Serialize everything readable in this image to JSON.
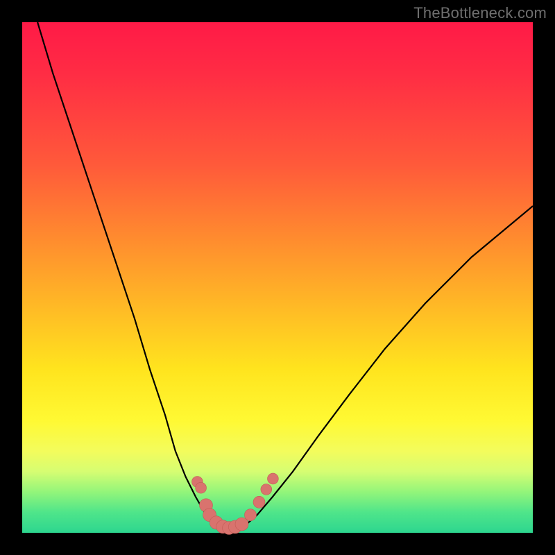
{
  "watermark": {
    "text": "TheBottleneck.com"
  },
  "colors": {
    "background": "#000000",
    "gradient_top": "#ff1a47",
    "gradient_mid": "#ffe41e",
    "gradient_bottom": "#2dd68f",
    "curve": "#000000",
    "marker_fill": "#d9736e",
    "marker_stroke": "#c35b55"
  },
  "chart_data": {
    "type": "line",
    "title": "",
    "xlabel": "",
    "ylabel": "",
    "xlim": [
      0,
      100
    ],
    "ylim": [
      0,
      100
    ],
    "grid": false,
    "legend": false,
    "series": [
      {
        "name": "left-branch",
        "x": [
          3,
          6,
          10,
          14,
          18,
          22,
          25,
          28,
          30,
          32,
          34,
          36,
          37.5
        ],
        "values": [
          100,
          90,
          78,
          66,
          54,
          42,
          32,
          23,
          16,
          11,
          7,
          3.5,
          1.3
        ]
      },
      {
        "name": "valley-floor",
        "x": [
          37.5,
          39,
          40.5,
          42,
          43.5
        ],
        "values": [
          1.3,
          0.9,
          0.8,
          0.9,
          1.3
        ]
      },
      {
        "name": "right-branch",
        "x": [
          43.5,
          46,
          49,
          53,
          58,
          64,
          71,
          79,
          88,
          100
        ],
        "values": [
          1.3,
          3.5,
          7,
          12,
          19,
          27,
          36,
          45,
          54,
          64
        ]
      }
    ],
    "markers": [
      {
        "x": 34.3,
        "y": 10.0,
        "r": 1.5
      },
      {
        "x": 35.0,
        "y": 8.8,
        "r": 1.5
      },
      {
        "x": 36.0,
        "y": 5.4,
        "r": 1.8
      },
      {
        "x": 36.7,
        "y": 3.5,
        "r": 1.8
      },
      {
        "x": 38.0,
        "y": 2.0,
        "r": 1.8
      },
      {
        "x": 39.3,
        "y": 1.2,
        "r": 1.8
      },
      {
        "x": 40.5,
        "y": 0.95,
        "r": 1.8
      },
      {
        "x": 41.7,
        "y": 1.15,
        "r": 1.8
      },
      {
        "x": 43.0,
        "y": 1.7,
        "r": 1.8
      },
      {
        "x": 44.7,
        "y": 3.5,
        "r": 1.6
      },
      {
        "x": 46.4,
        "y": 6.0,
        "r": 1.6
      },
      {
        "x": 47.8,
        "y": 8.5,
        "r": 1.5
      },
      {
        "x": 49.1,
        "y": 10.6,
        "r": 1.5
      }
    ]
  }
}
